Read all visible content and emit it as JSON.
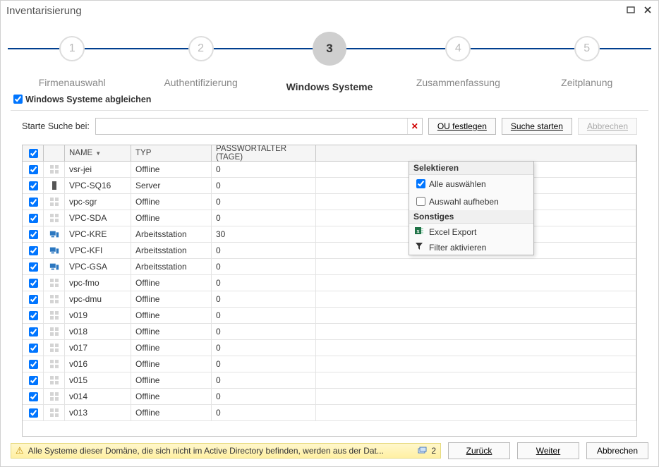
{
  "window_title": "Inventarisierung",
  "stepper": {
    "steps": [
      {
        "num": "1",
        "label": "Firmenauswahl",
        "active": false
      },
      {
        "num": "2",
        "label": "Authentifizierung",
        "active": false
      },
      {
        "num": "3",
        "label": "Windows Systeme",
        "active": true
      },
      {
        "num": "4",
        "label": "Zusammenfassung",
        "active": false
      },
      {
        "num": "5",
        "label": "Zeitplanung",
        "active": false
      }
    ]
  },
  "sync_checkbox_label": "Windows Systeme abgleichen",
  "search": {
    "label": "Starte Suche bei:",
    "value": "",
    "ou_button": "OU festlegen",
    "ou_button_key": "O",
    "start_button": "Suche starten",
    "start_button_key": "S",
    "cancel_button": "Abbrechen",
    "cancel_button_key": "A"
  },
  "table": {
    "headers": {
      "name": "NAME",
      "type": "TYP",
      "age": "PASSWORTALTER (TAGE)"
    },
    "rows": [
      {
        "checked": true,
        "icon": "offline",
        "name": "vsr-jei",
        "type": "Offline",
        "age": "0"
      },
      {
        "checked": true,
        "icon": "server",
        "name": "VPC-SQ16",
        "type": "Server",
        "age": "0"
      },
      {
        "checked": true,
        "icon": "offline",
        "name": "vpc-sgr",
        "type": "Offline",
        "age": "0"
      },
      {
        "checked": true,
        "icon": "offline",
        "name": "VPC-SDA",
        "type": "Offline",
        "age": "0"
      },
      {
        "checked": true,
        "icon": "workstation",
        "name": "VPC-KRE",
        "type": "Arbeitsstation",
        "age": "30"
      },
      {
        "checked": true,
        "icon": "workstation",
        "name": "VPC-KFI",
        "type": "Arbeitsstation",
        "age": "0"
      },
      {
        "checked": true,
        "icon": "workstation",
        "name": "VPC-GSA",
        "type": "Arbeitsstation",
        "age": "0"
      },
      {
        "checked": true,
        "icon": "offline",
        "name": "vpc-fmo",
        "type": "Offline",
        "age": "0"
      },
      {
        "checked": true,
        "icon": "offline",
        "name": "vpc-dmu",
        "type": "Offline",
        "age": "0"
      },
      {
        "checked": true,
        "icon": "offline",
        "name": "v019",
        "type": "Offline",
        "age": "0"
      },
      {
        "checked": true,
        "icon": "offline",
        "name": "v018",
        "type": "Offline",
        "age": "0"
      },
      {
        "checked": true,
        "icon": "offline",
        "name": "v017",
        "type": "Offline",
        "age": "0"
      },
      {
        "checked": true,
        "icon": "offline",
        "name": "v016",
        "type": "Offline",
        "age": "0"
      },
      {
        "checked": true,
        "icon": "offline",
        "name": "v015",
        "type": "Offline",
        "age": "0"
      },
      {
        "checked": true,
        "icon": "offline",
        "name": "v014",
        "type": "Offline",
        "age": "0"
      },
      {
        "checked": true,
        "icon": "offline",
        "name": "v013",
        "type": "Offline",
        "age": "0"
      }
    ]
  },
  "context_menu": {
    "section1": "Selektieren",
    "select_all": "Alle auswählen",
    "select_all_checked": true,
    "deselect_all": "Auswahl aufheben",
    "deselect_all_checked": false,
    "section2": "Sonstiges",
    "excel_export": "Excel Export",
    "filter_activate": "Filter aktivieren"
  },
  "warning": {
    "text": "Alle Systeme dieser Domäne, die sich nicht im Active Directory befinden, werden aus der Dat...",
    "count": "2"
  },
  "footer_buttons": {
    "back": "Zurück",
    "back_key": "Z",
    "next": "Weiter",
    "next_key": "W",
    "cancel": "Abbrechen"
  }
}
